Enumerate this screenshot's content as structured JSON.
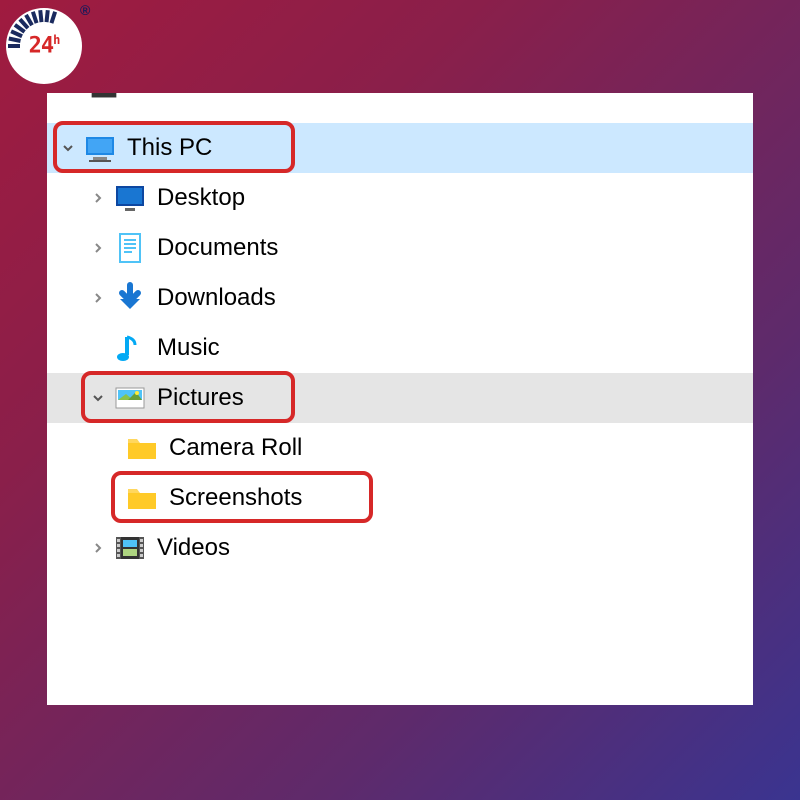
{
  "logo": {
    "text": "24",
    "sup": "h",
    "registered": "®"
  },
  "tree": {
    "this_pc": "This PC",
    "desktop": "Desktop",
    "documents": "Documents",
    "downloads": "Downloads",
    "music": "Music",
    "pictures": "Pictures",
    "camera_roll": "Camera Roll",
    "screenshots": "Screenshots",
    "videos": "Videos"
  },
  "highlights": [
    "this-pc",
    "pictures",
    "screenshots"
  ]
}
